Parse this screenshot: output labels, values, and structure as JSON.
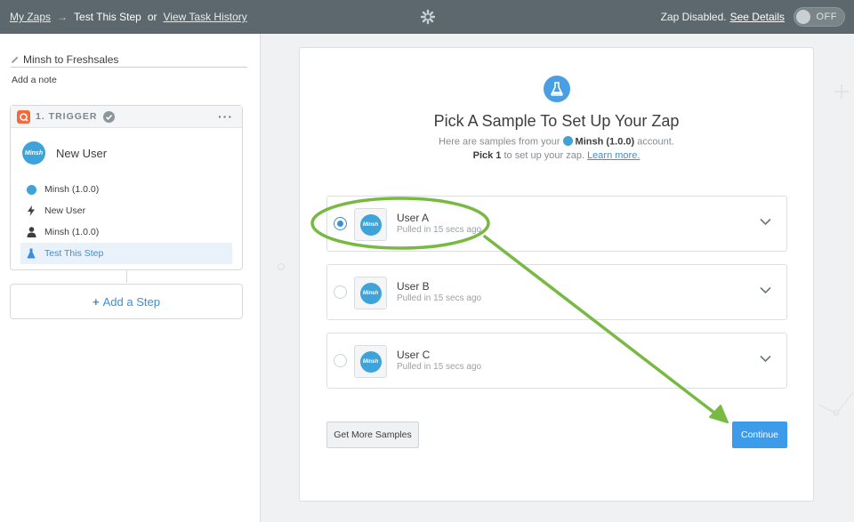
{
  "header": {
    "my_zaps": "My Zaps",
    "arrow": "→",
    "current_step": "Test This Step",
    "or": "or",
    "task_history": "View Task History",
    "zap_status": "Zap Disabled.",
    "see_details": "See Details",
    "toggle_label": "OFF"
  },
  "sidebar": {
    "zap_name": "Minsh to Freshsales",
    "add_note": "Add a note",
    "trigger": {
      "label": "1. TRIGGER",
      "menu": "···",
      "app_logo_text": "Minsh",
      "title": "New User",
      "steps": [
        {
          "icon": "app-logo",
          "label": "Minsh (1.0.0)"
        },
        {
          "icon": "bolt-icon",
          "label": "New User"
        },
        {
          "icon": "person-icon",
          "label": "Minsh (1.0.0)"
        },
        {
          "icon": "flask-icon",
          "label": "Test This Step"
        }
      ]
    },
    "add_step": {
      "plus": "+",
      "label": "Add a Step"
    }
  },
  "main": {
    "heading": "Pick A Sample To Set Up Your Zap",
    "sub1_pre": "Here are samples from your",
    "sub1_account": "Minsh (1.0.0)",
    "sub1_post": "account.",
    "sub2_pick": "Pick 1",
    "sub2_mid": "to set up your zap.",
    "sub2_learn": "Learn more.",
    "samples": [
      {
        "name": "User A",
        "pulled": "Pulled in 15 secs ago",
        "selected": true
      },
      {
        "name": "User B",
        "pulled": "Pulled in 15 secs ago",
        "selected": false
      },
      {
        "name": "User C",
        "pulled": "Pulled in 15 secs ago",
        "selected": false
      }
    ],
    "logo_text": "Minsh",
    "more_button": "Get More Samples",
    "continue_button": "Continue"
  },
  "colors": {
    "topbar": "#5c686e",
    "accent": "#3d9be9",
    "annotation": "#78b943",
    "trigger_icon": "#f26b3a"
  }
}
